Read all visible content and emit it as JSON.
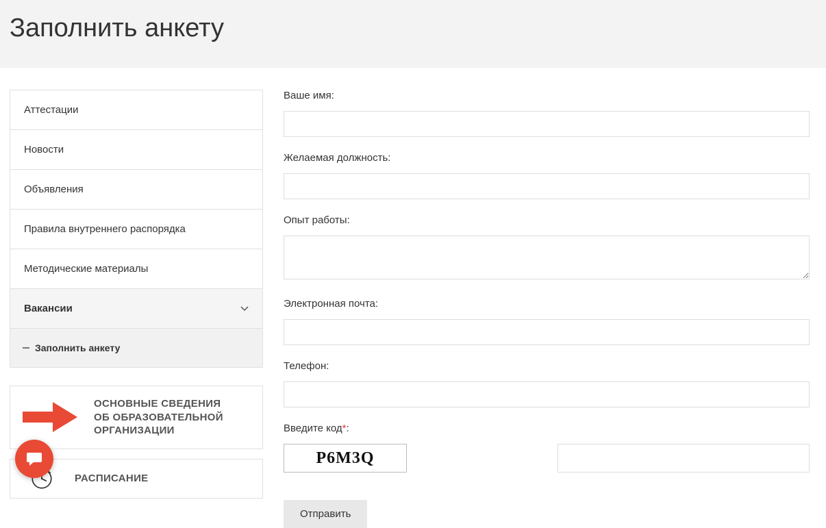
{
  "page_title": "Заполнить анкету",
  "sidebar": {
    "items": [
      {
        "label": "Аттестации"
      },
      {
        "label": "Новости"
      },
      {
        "label": "Объявления"
      },
      {
        "label": "Правила внутреннего распорядка"
      },
      {
        "label": "Методические материалы"
      },
      {
        "label": "Вакансии",
        "expandable": true
      },
      {
        "label": "Заполнить анкету",
        "active": true
      }
    ]
  },
  "promo1": {
    "line1": "ОСНОВНЫЕ СВЕДЕНИЯ",
    "line2": "ОБ ОБРАЗОВАТЕЛЬНОЙ",
    "line3": "ОРГАНИЗАЦИИ"
  },
  "promo2": {
    "text": "РАСПИСАНИЕ"
  },
  "form": {
    "name_label": "Ваше имя:",
    "position_label": "Желаемая должность:",
    "experience_label": "Опыт работы:",
    "email_label": "Электронная почта:",
    "phone_label": "Телефон:",
    "captcha_label": "Введите код",
    "submit_label": "Отправить"
  },
  "captcha": {
    "value": "P6M3Q"
  }
}
